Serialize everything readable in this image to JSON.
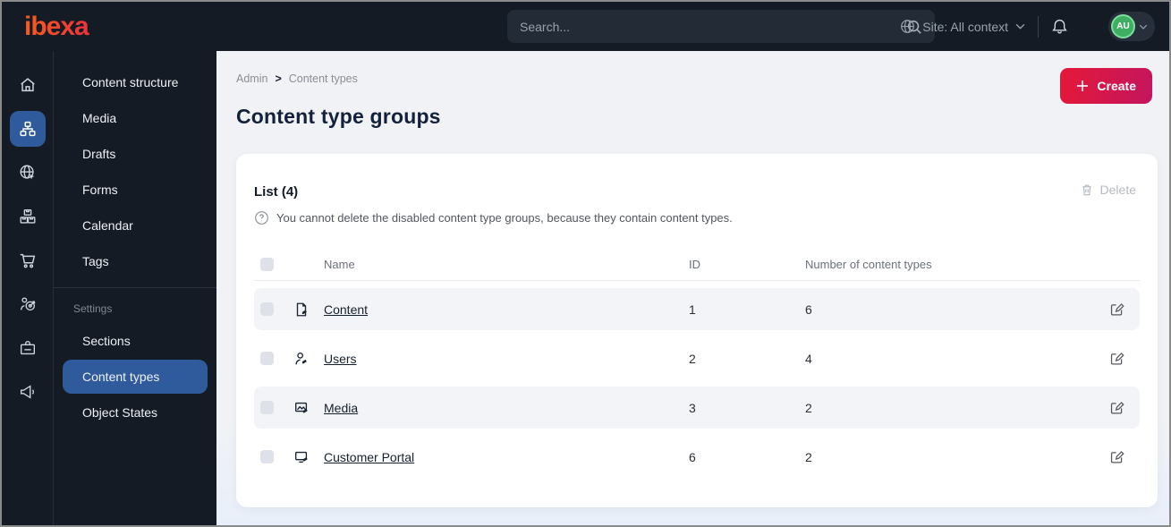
{
  "topbar": {
    "brand": "ibexa",
    "search_placeholder": "Search...",
    "site_context": "Site: All context",
    "avatar_initials": "AU"
  },
  "sidebar": {
    "rail_icons": [
      "home-icon",
      "content-tree-icon",
      "site-globe-icon",
      "products-icon",
      "commerce-cart-icon",
      "personalization-target-icon",
      "corporate-badge-icon",
      "marketing-megaphone-icon"
    ],
    "menu_items": [
      "Content structure",
      "Media",
      "Drafts",
      "Forms",
      "Calendar",
      "Tags"
    ],
    "section_label": "Settings",
    "settings_items": [
      "Sections",
      "Content types",
      "Object States"
    ],
    "active_item": "Content types"
  },
  "page": {
    "breadcrumb": [
      "Admin",
      "Content types"
    ],
    "breadcrumb_separator": ">",
    "title": "Content type groups",
    "create_label": "Create"
  },
  "list": {
    "title": "List (4)",
    "hint": "You cannot delete the disabled content type groups, because they contain content types.",
    "delete_label": "Delete",
    "columns": [
      "Name",
      "ID",
      "Number of content types"
    ],
    "rows": [
      {
        "name": "Content",
        "id": "1",
        "count": "6",
        "icon": "file-edit-icon"
      },
      {
        "name": "Users",
        "id": "2",
        "count": "4",
        "icon": "user-edit-icon"
      },
      {
        "name": "Media",
        "id": "3",
        "count": "2",
        "icon": "image-edit-icon"
      },
      {
        "name": "Customer Portal",
        "id": "6",
        "count": "2",
        "icon": "screen-edit-icon"
      }
    ]
  },
  "colors": {
    "topbar_bg": "#141b25",
    "active_blue": "#2f5b9c",
    "create_gradient_start": "#e41938",
    "create_gradient_end": "#c4155f",
    "avatar_green": "#3fae62",
    "row_alt_bg": "#f3f4f7"
  }
}
